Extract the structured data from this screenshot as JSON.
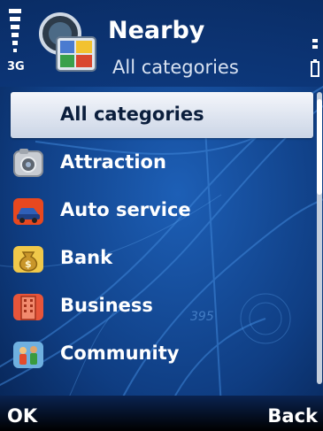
{
  "status": {
    "network": "3G"
  },
  "header": {
    "title": "Nearby",
    "subtitle": "All categories"
  },
  "list": {
    "items": [
      {
        "label": "All categories",
        "icon": "none",
        "selected": true
      },
      {
        "label": "Attraction",
        "icon": "camera-icon"
      },
      {
        "label": "Auto service",
        "icon": "car-icon"
      },
      {
        "label": "Bank",
        "icon": "money-bag-icon"
      },
      {
        "label": "Business",
        "icon": "building-icon"
      },
      {
        "label": "Community",
        "icon": "people-icon"
      }
    ]
  },
  "softkeys": {
    "left": "OK",
    "right": "Back"
  }
}
